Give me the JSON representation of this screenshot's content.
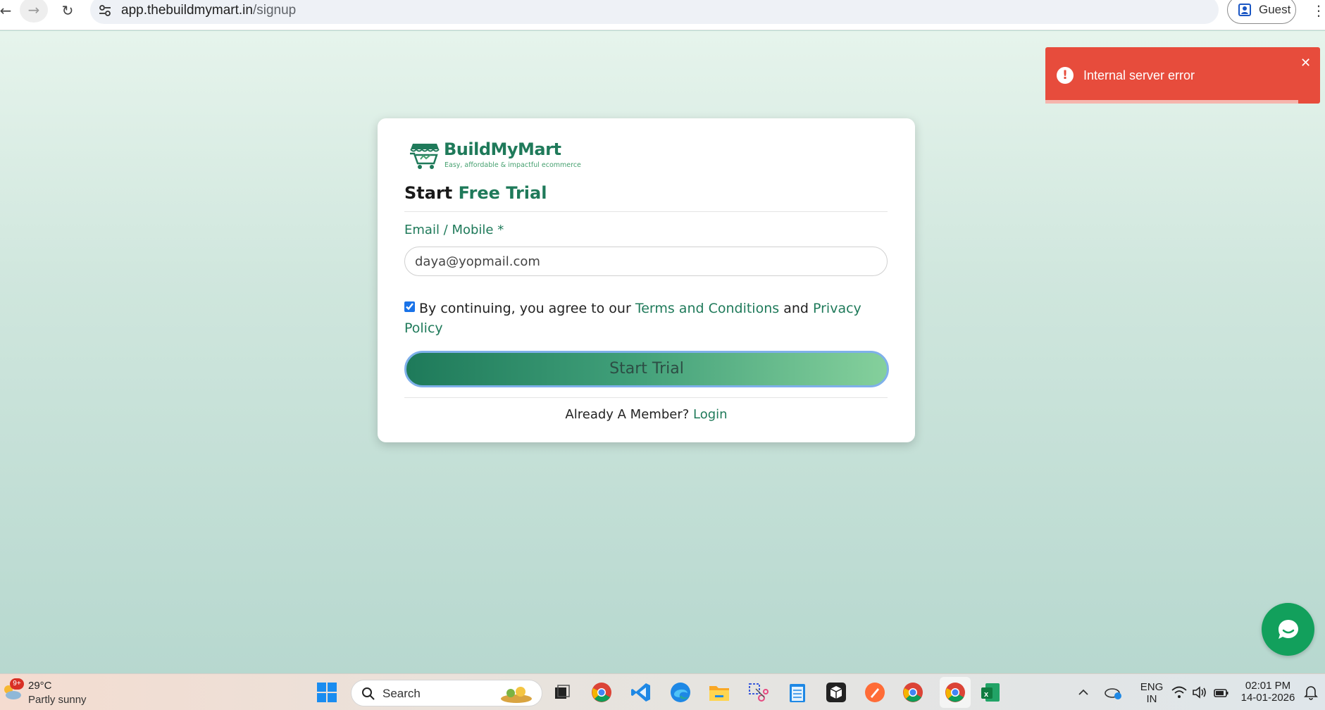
{
  "browser": {
    "url_host": "app.thebuildmymart.in",
    "url_path": "/signup",
    "profile_label": "Guest"
  },
  "brand": {
    "name": "BuildMyMart",
    "tagline": "Easy, affordable & impactful ecommerce",
    "color": "#1f7a5a"
  },
  "form": {
    "title_prefix": "Start",
    "title_accent": "Free Trial",
    "email_label": "Email / Mobile *",
    "email_value": "daya@yopmail.com",
    "consent_prefix": "By continuing, you agree to our",
    "terms_link": "Terms and Conditions",
    "consent_and": "and",
    "privacy_link": "Privacy Policy",
    "consent_checked": true,
    "submit_label": "Start Trial",
    "member_prompt": "Already A Member?",
    "login_link": "Login"
  },
  "toast": {
    "message": "Internal server error",
    "color": "#e74c3c",
    "progress": 0.92
  },
  "taskbar": {
    "weather_badge": "9+",
    "weather_temp": "29°C",
    "weather_desc": "Partly sunny",
    "search_placeholder": "Search",
    "lang_line1": "ENG",
    "lang_line2": "IN",
    "time": "02:01 PM",
    "date": "14-01-2026"
  }
}
